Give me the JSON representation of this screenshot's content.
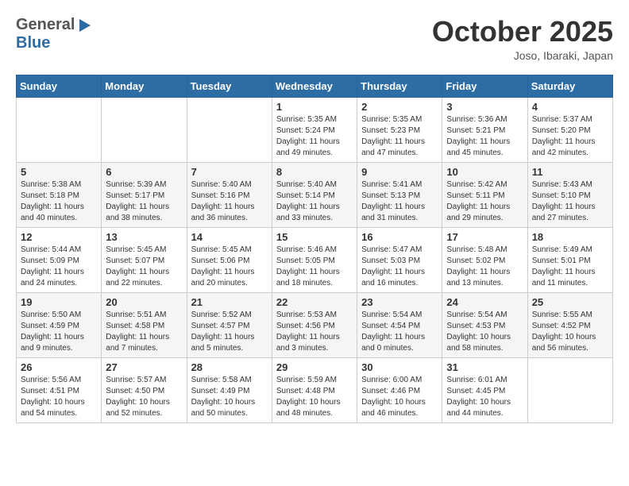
{
  "header": {
    "logo_general": "General",
    "logo_blue": "Blue",
    "month_title": "October 2025",
    "location": "Joso, Ibaraki, Japan"
  },
  "days_of_week": [
    "Sunday",
    "Monday",
    "Tuesday",
    "Wednesday",
    "Thursday",
    "Friday",
    "Saturday"
  ],
  "weeks": [
    [
      {
        "day": "",
        "sunrise": "",
        "sunset": "",
        "daylight": ""
      },
      {
        "day": "",
        "sunrise": "",
        "sunset": "",
        "daylight": ""
      },
      {
        "day": "",
        "sunrise": "",
        "sunset": "",
        "daylight": ""
      },
      {
        "day": "1",
        "sunrise": "Sunrise: 5:35 AM",
        "sunset": "Sunset: 5:24 PM",
        "daylight": "Daylight: 11 hours and 49 minutes."
      },
      {
        "day": "2",
        "sunrise": "Sunrise: 5:35 AM",
        "sunset": "Sunset: 5:23 PM",
        "daylight": "Daylight: 11 hours and 47 minutes."
      },
      {
        "day": "3",
        "sunrise": "Sunrise: 5:36 AM",
        "sunset": "Sunset: 5:21 PM",
        "daylight": "Daylight: 11 hours and 45 minutes."
      },
      {
        "day": "4",
        "sunrise": "Sunrise: 5:37 AM",
        "sunset": "Sunset: 5:20 PM",
        "daylight": "Daylight: 11 hours and 42 minutes."
      }
    ],
    [
      {
        "day": "5",
        "sunrise": "Sunrise: 5:38 AM",
        "sunset": "Sunset: 5:18 PM",
        "daylight": "Daylight: 11 hours and 40 minutes."
      },
      {
        "day": "6",
        "sunrise": "Sunrise: 5:39 AM",
        "sunset": "Sunset: 5:17 PM",
        "daylight": "Daylight: 11 hours and 38 minutes."
      },
      {
        "day": "7",
        "sunrise": "Sunrise: 5:40 AM",
        "sunset": "Sunset: 5:16 PM",
        "daylight": "Daylight: 11 hours and 36 minutes."
      },
      {
        "day": "8",
        "sunrise": "Sunrise: 5:40 AM",
        "sunset": "Sunset: 5:14 PM",
        "daylight": "Daylight: 11 hours and 33 minutes."
      },
      {
        "day": "9",
        "sunrise": "Sunrise: 5:41 AM",
        "sunset": "Sunset: 5:13 PM",
        "daylight": "Daylight: 11 hours and 31 minutes."
      },
      {
        "day": "10",
        "sunrise": "Sunrise: 5:42 AM",
        "sunset": "Sunset: 5:11 PM",
        "daylight": "Daylight: 11 hours and 29 minutes."
      },
      {
        "day": "11",
        "sunrise": "Sunrise: 5:43 AM",
        "sunset": "Sunset: 5:10 PM",
        "daylight": "Daylight: 11 hours and 27 minutes."
      }
    ],
    [
      {
        "day": "12",
        "sunrise": "Sunrise: 5:44 AM",
        "sunset": "Sunset: 5:09 PM",
        "daylight": "Daylight: 11 hours and 24 minutes."
      },
      {
        "day": "13",
        "sunrise": "Sunrise: 5:45 AM",
        "sunset": "Sunset: 5:07 PM",
        "daylight": "Daylight: 11 hours and 22 minutes."
      },
      {
        "day": "14",
        "sunrise": "Sunrise: 5:45 AM",
        "sunset": "Sunset: 5:06 PM",
        "daylight": "Daylight: 11 hours and 20 minutes."
      },
      {
        "day": "15",
        "sunrise": "Sunrise: 5:46 AM",
        "sunset": "Sunset: 5:05 PM",
        "daylight": "Daylight: 11 hours and 18 minutes."
      },
      {
        "day": "16",
        "sunrise": "Sunrise: 5:47 AM",
        "sunset": "Sunset: 5:03 PM",
        "daylight": "Daylight: 11 hours and 16 minutes."
      },
      {
        "day": "17",
        "sunrise": "Sunrise: 5:48 AM",
        "sunset": "Sunset: 5:02 PM",
        "daylight": "Daylight: 11 hours and 13 minutes."
      },
      {
        "day": "18",
        "sunrise": "Sunrise: 5:49 AM",
        "sunset": "Sunset: 5:01 PM",
        "daylight": "Daylight: 11 hours and 11 minutes."
      }
    ],
    [
      {
        "day": "19",
        "sunrise": "Sunrise: 5:50 AM",
        "sunset": "Sunset: 4:59 PM",
        "daylight": "Daylight: 11 hours and 9 minutes."
      },
      {
        "day": "20",
        "sunrise": "Sunrise: 5:51 AM",
        "sunset": "Sunset: 4:58 PM",
        "daylight": "Daylight: 11 hours and 7 minutes."
      },
      {
        "day": "21",
        "sunrise": "Sunrise: 5:52 AM",
        "sunset": "Sunset: 4:57 PM",
        "daylight": "Daylight: 11 hours and 5 minutes."
      },
      {
        "day": "22",
        "sunrise": "Sunrise: 5:53 AM",
        "sunset": "Sunset: 4:56 PM",
        "daylight": "Daylight: 11 hours and 3 minutes."
      },
      {
        "day": "23",
        "sunrise": "Sunrise: 5:54 AM",
        "sunset": "Sunset: 4:54 PM",
        "daylight": "Daylight: 11 hours and 0 minutes."
      },
      {
        "day": "24",
        "sunrise": "Sunrise: 5:54 AM",
        "sunset": "Sunset: 4:53 PM",
        "daylight": "Daylight: 10 hours and 58 minutes."
      },
      {
        "day": "25",
        "sunrise": "Sunrise: 5:55 AM",
        "sunset": "Sunset: 4:52 PM",
        "daylight": "Daylight: 10 hours and 56 minutes."
      }
    ],
    [
      {
        "day": "26",
        "sunrise": "Sunrise: 5:56 AM",
        "sunset": "Sunset: 4:51 PM",
        "daylight": "Daylight: 10 hours and 54 minutes."
      },
      {
        "day": "27",
        "sunrise": "Sunrise: 5:57 AM",
        "sunset": "Sunset: 4:50 PM",
        "daylight": "Daylight: 10 hours and 52 minutes."
      },
      {
        "day": "28",
        "sunrise": "Sunrise: 5:58 AM",
        "sunset": "Sunset: 4:49 PM",
        "daylight": "Daylight: 10 hours and 50 minutes."
      },
      {
        "day": "29",
        "sunrise": "Sunrise: 5:59 AM",
        "sunset": "Sunset: 4:48 PM",
        "daylight": "Daylight: 10 hours and 48 minutes."
      },
      {
        "day": "30",
        "sunrise": "Sunrise: 6:00 AM",
        "sunset": "Sunset: 4:46 PM",
        "daylight": "Daylight: 10 hours and 46 minutes."
      },
      {
        "day": "31",
        "sunrise": "Sunrise: 6:01 AM",
        "sunset": "Sunset: 4:45 PM",
        "daylight": "Daylight: 10 hours and 44 minutes."
      },
      {
        "day": "",
        "sunrise": "",
        "sunset": "",
        "daylight": ""
      }
    ]
  ]
}
